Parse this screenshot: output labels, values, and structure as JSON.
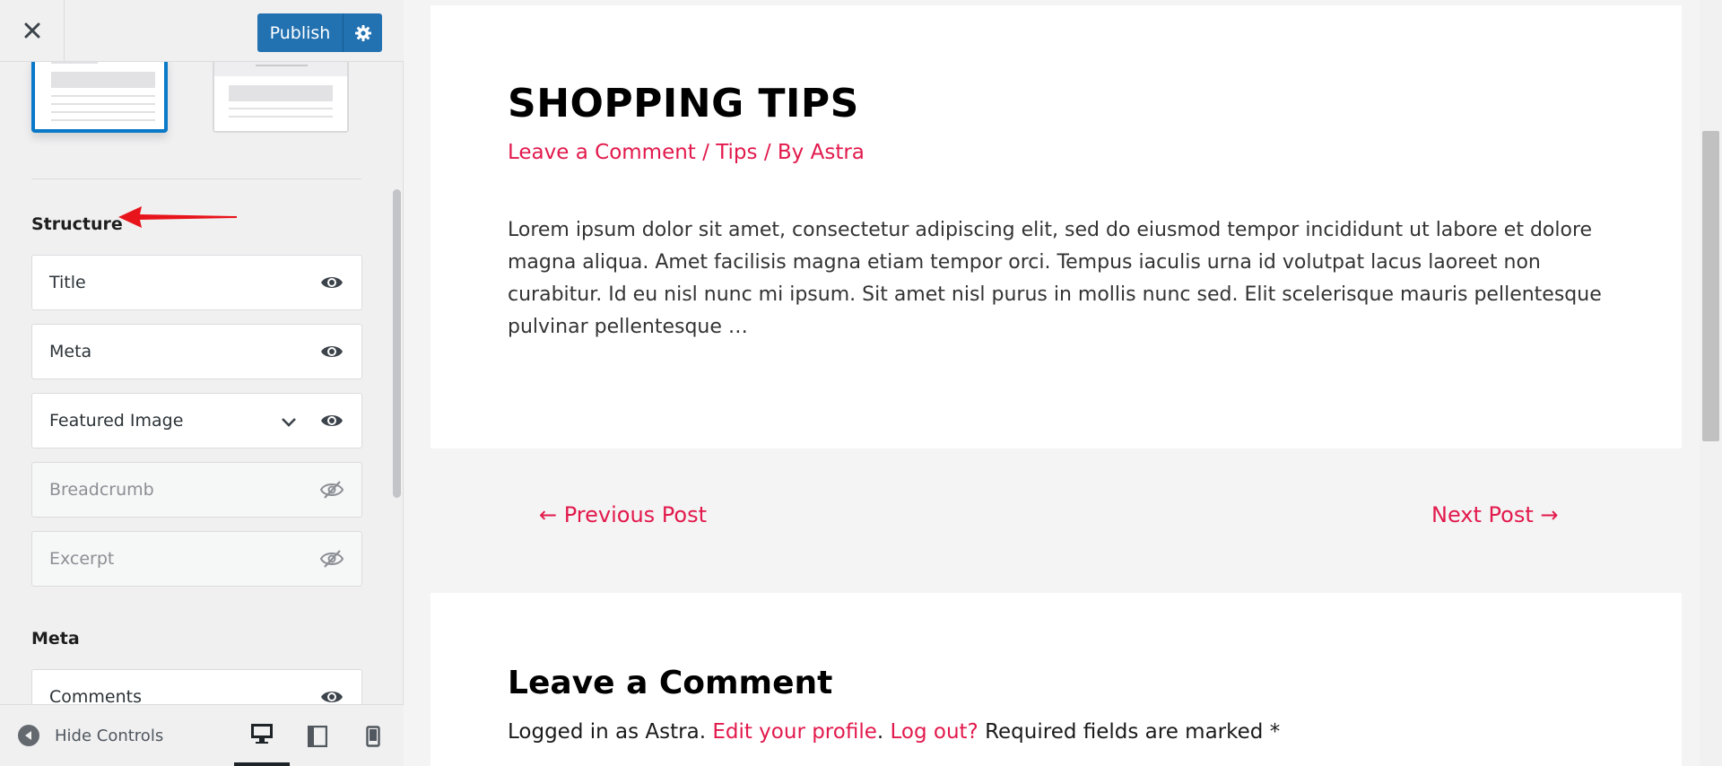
{
  "sidebar": {
    "publish_label": "Publish",
    "sections": {
      "structure_title": "Structure",
      "meta_title": "Meta"
    },
    "structure_items": [
      {
        "label": "Title",
        "visible": true
      },
      {
        "label": "Meta",
        "visible": true
      },
      {
        "label": "Featured Image",
        "visible": true,
        "expandable": true
      },
      {
        "label": "Breadcrumb",
        "visible": false
      },
      {
        "label": "Excerpt",
        "visible": false
      }
    ],
    "meta_items": [
      {
        "label": "Comments",
        "visible": true
      }
    ],
    "footer": {
      "hide_controls_label": "Hide Controls",
      "devices": [
        "desktop",
        "tablet",
        "mobile"
      ],
      "active_device": "desktop"
    }
  },
  "preview": {
    "post": {
      "title": "SHOPPING TIPS",
      "meta": {
        "comment_link": "Leave a Comment",
        "sep1": " / ",
        "category": "Tips",
        "sep2": " / By ",
        "author": "Astra"
      },
      "excerpt": "Lorem ipsum dolor sit amet, consectetur adipiscing elit, sed do eiusmod tempor incididunt ut labore et dolore magna aliqua. Amet facilisis magna etiam tempor orci. Tempus iaculis urna id volutpat lacus laoreet non curabitur. Id eu nisl nunc mi ipsum. Sit amet nisl purus in mollis nunc sed. Elit scelerisque mauris pellentesque pulvinar pellentesque …"
    },
    "navigation": {
      "prev": "← Previous Post",
      "next": "Next Post →"
    },
    "comments": {
      "title": "Leave a Comment",
      "logged_prefix": "Logged in as Astra. ",
      "edit_profile": "Edit your profile",
      "dot": ". ",
      "logout": "Log out?",
      "required": " Required fields are marked *"
    }
  },
  "colors": {
    "accent": "#e2194c",
    "publish": "#2271b1",
    "selected_layout": "#0a79c8",
    "arrow": "#e8141b"
  }
}
